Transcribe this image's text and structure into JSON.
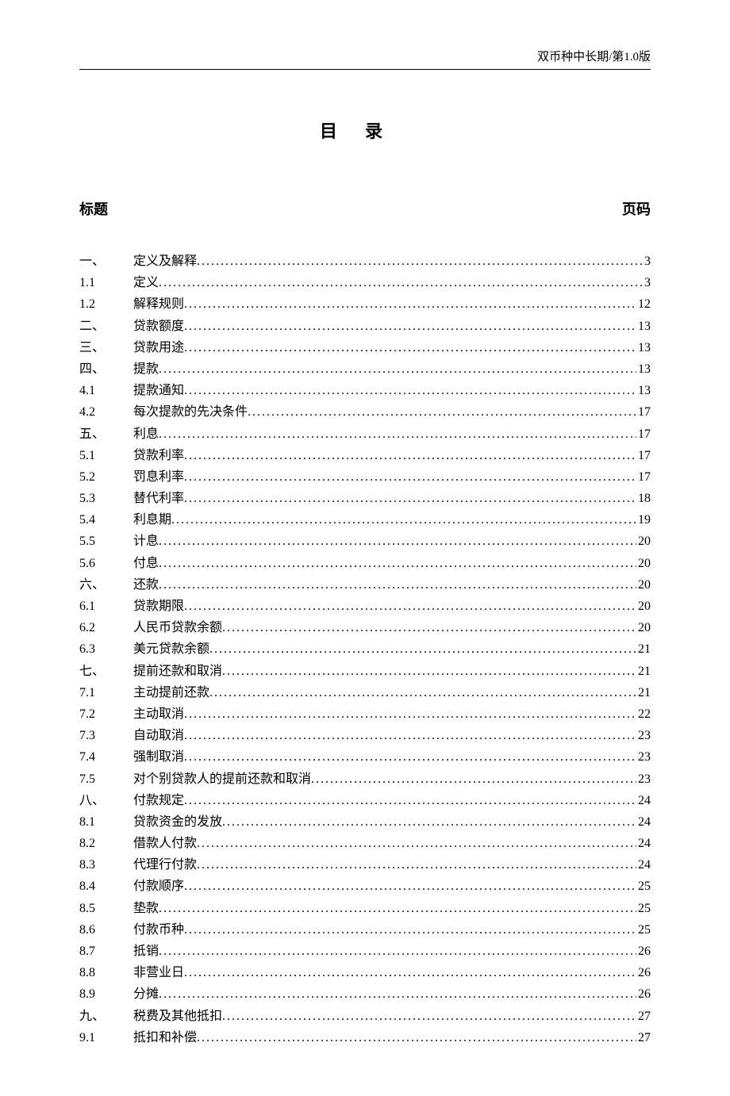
{
  "header": "双币种中长期/第1.0版",
  "title": "目录",
  "col_title": "标题",
  "col_page": "页码",
  "toc": [
    {
      "num": "一、",
      "label": "定义及解释",
      "page": "3"
    },
    {
      "num": "1.1",
      "label": "定义",
      "page": "3"
    },
    {
      "num": "1.2",
      "label": "解释规则",
      "page": "12"
    },
    {
      "num": "二、",
      "label": "贷款额度",
      "page": "13"
    },
    {
      "num": "三、",
      "label": "贷款用途",
      "page": "13"
    },
    {
      "num": "四、",
      "label": "提款",
      "page": "13"
    },
    {
      "num": "4.1",
      "label": "提款通知",
      "page": "13"
    },
    {
      "num": "4.2",
      "label": "每次提款的先决条件",
      "page": "17"
    },
    {
      "num": "五、",
      "label": "利息",
      "page": "17"
    },
    {
      "num": "5.1",
      "label": "贷款利率",
      "page": "17"
    },
    {
      "num": "5.2",
      "label": "罚息利率",
      "page": "17"
    },
    {
      "num": "5.3",
      "label": "替代利率",
      "page": "18"
    },
    {
      "num": "5.4",
      "label": "利息期",
      "page": "19"
    },
    {
      "num": "5.5",
      "label": "计息",
      "page": "20"
    },
    {
      "num": "5.6",
      "label": "付息",
      "page": "20"
    },
    {
      "num": "六、",
      "label": "还款",
      "page": "20"
    },
    {
      "num": "6.1",
      "label": "贷款期限",
      "page": "20"
    },
    {
      "num": "6.2",
      "label": "人民币贷款余额",
      "page": "20"
    },
    {
      "num": "6.3",
      "label": "美元贷款余额",
      "page": "21"
    },
    {
      "num": "七、",
      "label": "提前还款和取消",
      "page": "21"
    },
    {
      "num": "7.1",
      "label": "主动提前还款",
      "page": "21"
    },
    {
      "num": "7.2",
      "label": "主动取消",
      "page": "22"
    },
    {
      "num": "7.3",
      "label": "自动取消",
      "page": "23"
    },
    {
      "num": "7.4",
      "label": "强制取消",
      "page": "23"
    },
    {
      "num": "7.5",
      "label": "对个别贷款人的提前还款和取消",
      "page": "23"
    },
    {
      "num": "八、",
      "label": "付款规定",
      "page": "24"
    },
    {
      "num": "8.1",
      "label": "贷款资金的发放",
      "page": "24"
    },
    {
      "num": "8.2",
      "label": "借款人付款",
      "page": "24"
    },
    {
      "num": "8.3",
      "label": "代理行付款",
      "page": "24"
    },
    {
      "num": "8.4",
      "label": "付款顺序",
      "page": "25"
    },
    {
      "num": "8.5",
      "label": "垫款",
      "page": "25"
    },
    {
      "num": "8.6",
      "label": "付款币种",
      "page": "25"
    },
    {
      "num": "8.7",
      "label": "抵销",
      "page": "26"
    },
    {
      "num": "8.8",
      "label": "非营业日",
      "page": "26"
    },
    {
      "num": "8.9",
      "label": "分摊",
      "page": "26"
    },
    {
      "num": "九、",
      "label": "税费及其他抵扣",
      "page": "27"
    },
    {
      "num": "9.1",
      "label": "抵扣和补偿",
      "page": "27"
    }
  ]
}
